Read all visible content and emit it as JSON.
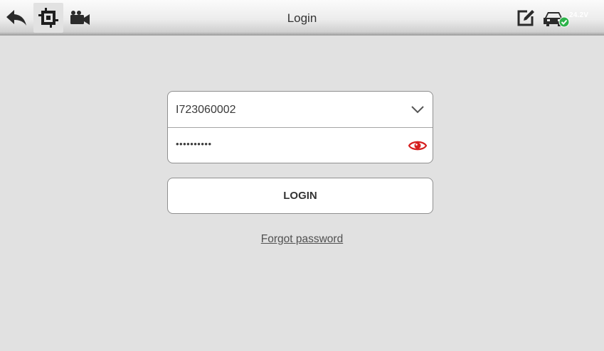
{
  "header": {
    "title": "Login",
    "voltage": "24.2V",
    "icons": {
      "back": "back-arrow-icon",
      "crop": "screenshot-crop-icon",
      "camera": "video-camera-icon",
      "edit": "edit-note-icon",
      "vehicle": "vehicle-connected-icon"
    }
  },
  "login_form": {
    "username": "I723060002",
    "password_masked": "••••••••••",
    "username_icon": "chevron-down-icon",
    "password_icon": "eye-icon",
    "login_label": "LOGIN",
    "forgot_label": "Forgot password"
  },
  "colors": {
    "background": "#e1e1e1",
    "eye_icon": "#d61f1f",
    "status_ok": "#2db24a"
  }
}
